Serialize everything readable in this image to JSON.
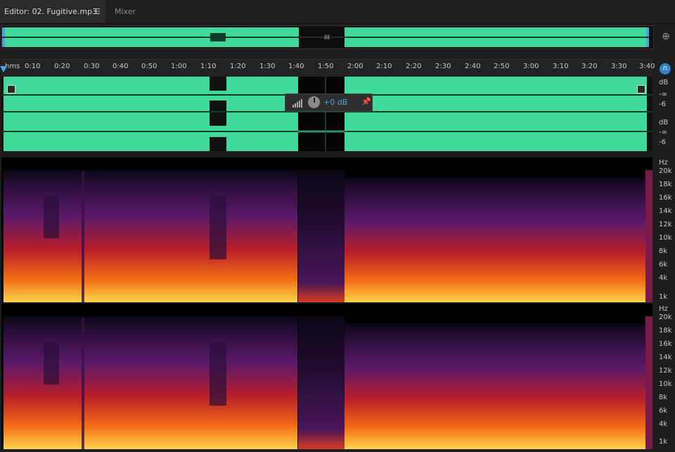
{
  "tabs": [
    {
      "label": "Editor: 02. Fugitive.mp3",
      "active": true
    },
    {
      "label": "Mixer",
      "active": false
    }
  ],
  "ruler": {
    "unit_label": "hms",
    "ticks": [
      "0:10",
      "0:20",
      "0:30",
      "0:40",
      "0:50",
      "1:00",
      "1:10",
      "1:20",
      "1:30",
      "1:40",
      "1:50",
      "2:00",
      "2:10",
      "2:20",
      "2:30",
      "2:40",
      "2:50",
      "3:00",
      "3:10",
      "3:20",
      "3:30",
      "3:40"
    ]
  },
  "amplitude_scale": {
    "unit": "dB",
    "labels": [
      "-∞",
      "-6"
    ]
  },
  "frequency_scale": {
    "unit": "Hz",
    "labels": [
      "20k",
      "18k",
      "16k",
      "14k",
      "12k",
      "10k",
      "8k",
      "6k",
      "4k",
      "1k"
    ]
  },
  "fader": {
    "value": "+0 dB"
  },
  "colors": {
    "waveform": "#3fd99a",
    "selection": "#000000",
    "accent": "#4aa3df"
  },
  "icons": {
    "zoom": "zoom-navigator-icon",
    "headphone": "headphone-icon",
    "pin": "pin-icon",
    "menu": "menu-icon"
  }
}
